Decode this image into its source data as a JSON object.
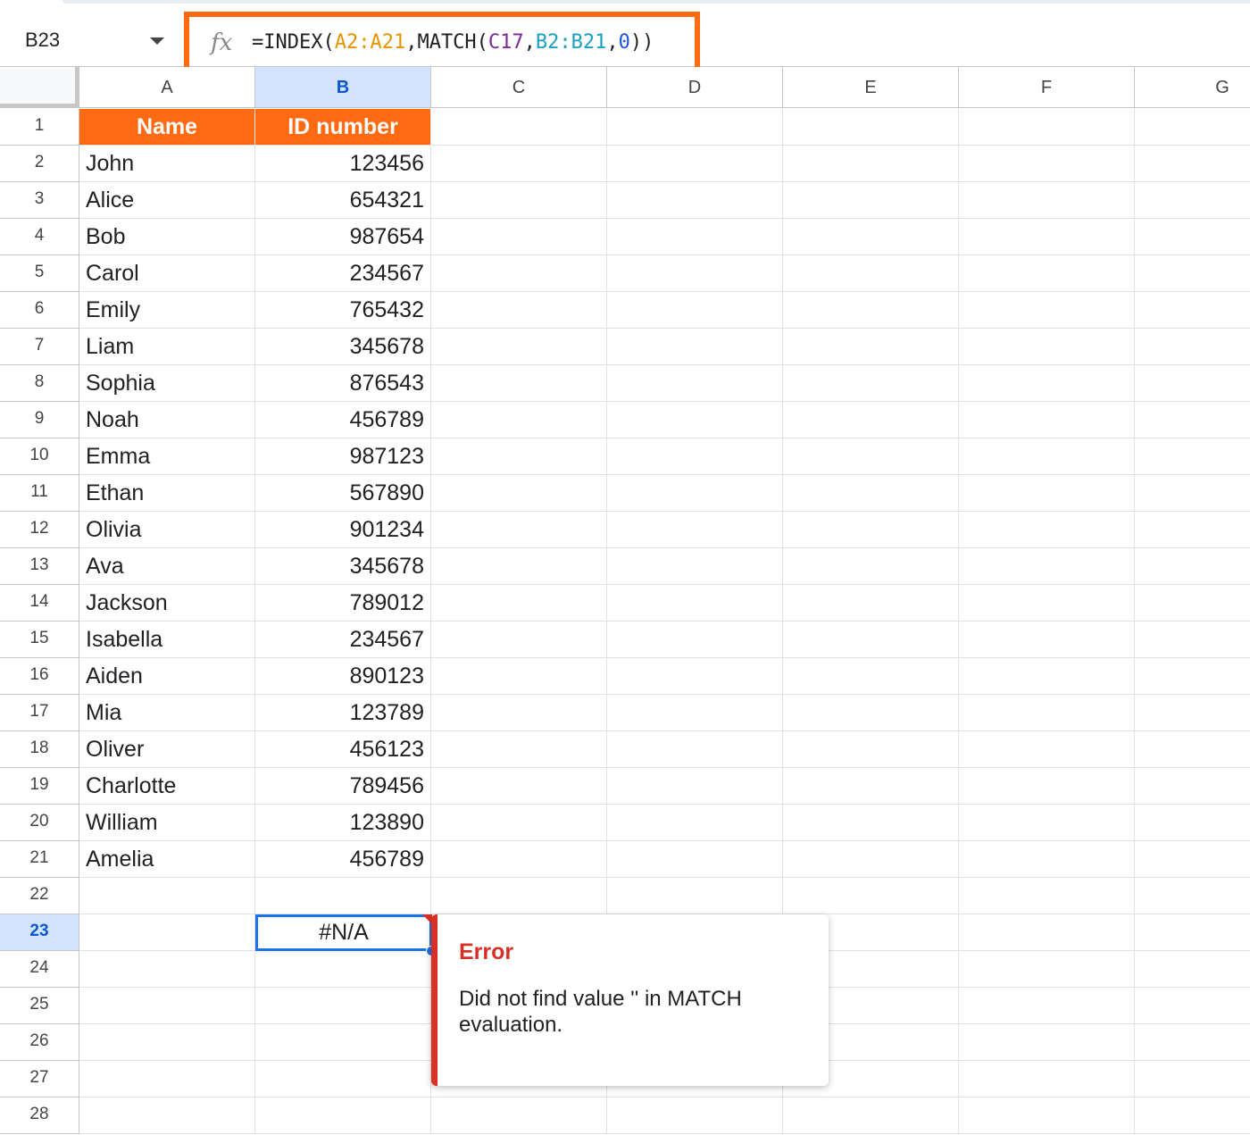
{
  "name_box": {
    "value": "B23"
  },
  "formula_bar": {
    "fx_icon": "fx-icon",
    "parts": [
      {
        "text": "=INDEX(",
        "cls": ""
      },
      {
        "text": "A2:A21",
        "cls": "c1"
      },
      {
        "text": ",MATCH(",
        "cls": ""
      },
      {
        "text": "C17",
        "cls": "c2"
      },
      {
        "text": ",",
        "cls": ""
      },
      {
        "text": "B2:B21",
        "cls": "c3"
      },
      {
        "text": ",",
        "cls": ""
      },
      {
        "text": "0",
        "cls": "c4"
      },
      {
        "text": "))",
        "cls": ""
      }
    ],
    "highlight_color": "#ff6a13"
  },
  "columns": [
    "A",
    "B",
    "C",
    "D",
    "E",
    "F",
    "G"
  ],
  "selected_column": "B",
  "row_numbers": [
    "1",
    "2",
    "3",
    "4",
    "5",
    "6",
    "7",
    "8",
    "9",
    "10",
    "11",
    "12",
    "13",
    "14",
    "15",
    "16",
    "17",
    "18",
    "19",
    "20",
    "21",
    "22",
    "23",
    "24",
    "25",
    "26",
    "27",
    "28"
  ],
  "selected_row": "23",
  "table": {
    "headers": [
      "Name",
      "ID number"
    ],
    "header_color": "#ff6a13",
    "rows": [
      [
        "John",
        "123456"
      ],
      [
        "Alice",
        "654321"
      ],
      [
        "Bob",
        "987654"
      ],
      [
        "Carol",
        "234567"
      ],
      [
        "Emily",
        "765432"
      ],
      [
        "Liam",
        "345678"
      ],
      [
        "Sophia",
        "876543"
      ],
      [
        "Noah",
        "456789"
      ],
      [
        "Emma",
        "987123"
      ],
      [
        "Ethan",
        "567890"
      ],
      [
        "Olivia",
        "901234"
      ],
      [
        "Ava",
        "345678"
      ],
      [
        "Jackson",
        "789012"
      ],
      [
        "Isabella",
        "234567"
      ],
      [
        "Aiden",
        "890123"
      ],
      [
        "Mia",
        "123789"
      ],
      [
        "Oliver",
        "456123"
      ],
      [
        "Charlotte",
        "789456"
      ],
      [
        "William",
        "123890"
      ],
      [
        "Amelia",
        "456789"
      ]
    ]
  },
  "active_cell": {
    "ref": "B23",
    "value": "#N/A"
  },
  "error_popup": {
    "title": "Error",
    "message": "Did not find value '' in MATCH evaluation.",
    "accent_color": "#d93025"
  }
}
